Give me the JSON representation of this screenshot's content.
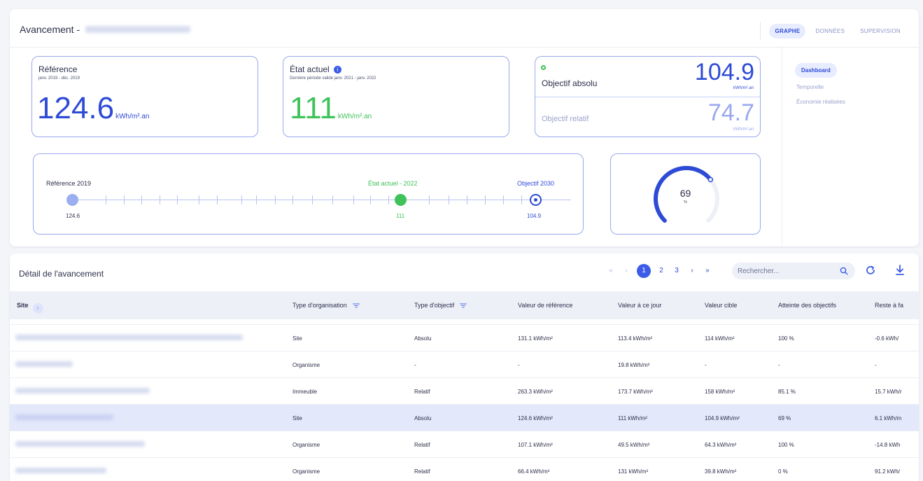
{
  "header": {
    "title": "Avancement -",
    "tabs": [
      {
        "label": "GRAPHE",
        "active": true
      },
      {
        "label": "DONNÉES",
        "active": false
      },
      {
        "label": "SUPERVISION",
        "active": false
      }
    ]
  },
  "reference": {
    "label": "Référence",
    "period": "janv. 2019 - déc. 2019",
    "value": "124.6",
    "unit": "kWh/m².an"
  },
  "current": {
    "label": "État actuel",
    "info_icon": "i",
    "period": "Dernière période valide janv. 2021 - janv. 2022",
    "value": "111",
    "unit": "kWh/m².an"
  },
  "objective": {
    "absolute_label": "Objectif absolu",
    "absolute_value": "104.9",
    "absolute_unit": "kWh/m².an",
    "relative_label": "Objectif relatif",
    "relative_value": "74.7",
    "relative_unit": "kWh/m².an"
  },
  "timeline": {
    "reference_label": "Référence 2019",
    "reference_value": "124.6",
    "current_label": "État actuel - 2022",
    "current_value": "111",
    "objective_label": "Objectif 2030",
    "objective_value": "104.9"
  },
  "gauge": {
    "value": "69",
    "unit": "%",
    "percent": 69
  },
  "side_nav": [
    {
      "label": "Dashboard",
      "active": true
    },
    {
      "label": "Temporelle",
      "active": false
    },
    {
      "label": "Économie réalisées",
      "active": false
    }
  ],
  "detail": {
    "title": "Détail de l'avancement",
    "pagination": {
      "first": "«",
      "prev": "‹",
      "pages": [
        "1",
        "2",
        "3"
      ],
      "current_page": "1",
      "next": "›",
      "last": "»"
    },
    "search_placeholder": "Rechercher...",
    "columns": [
      "Site",
      "Type d'organisation",
      "Type d'objectif",
      "Valeur de référence",
      "Valeur à ce jour",
      "Valeur cible",
      "Atteinte des objectifs",
      "Reste à fa"
    ],
    "rows": [
      {
        "org": "Site",
        "objective": "Absolu",
        "ref": "131.1 kWh/m²",
        "today": "113.4 kWh/m²",
        "target": "114 kWh/m²",
        "reach": "100 %",
        "rest": "-0.6 kWh/",
        "highlight": false
      },
      {
        "org": "Organisme",
        "objective": "-",
        "ref": "-",
        "today": "19.8 kWh/m²",
        "target": "-",
        "reach": "-",
        "rest": "-",
        "highlight": false
      },
      {
        "org": "Immeuble",
        "objective": "Relatif",
        "ref": "263.3 kWh/m²",
        "today": "173.7 kWh/m²",
        "target": "158 kWh/m²",
        "reach": "85.1 %",
        "rest": "15.7 kWh/r",
        "highlight": false
      },
      {
        "org": "Site",
        "objective": "Absolu",
        "ref": "124.6 kWh/m²",
        "today": "111 kWh/m²",
        "target": "104.9 kWh/m²",
        "reach": "69 %",
        "rest": "6.1 kWh/m",
        "highlight": true
      },
      {
        "org": "Organisme",
        "objective": "Relatif",
        "ref": "107.1 kWh/m²",
        "today": "49.5 kWh/m²",
        "target": "64.3 kWh/m²",
        "reach": "100 %",
        "rest": "-14.8 kWh",
        "highlight": false
      },
      {
        "org": "Organisme",
        "objective": "Relatif",
        "ref": "66.4 kWh/m²",
        "today": "131 kWh/m²",
        "target": "39.8 kWh/m²",
        "reach": "0 %",
        "rest": "91.2 kWh/",
        "highlight": false
      }
    ]
  },
  "colors": {
    "primary": "#2e4bd6",
    "accent": "#3b5ce6",
    "success": "#3fc25a",
    "border": "#9aa8ee",
    "highlight_row": "#e3e8fb"
  }
}
